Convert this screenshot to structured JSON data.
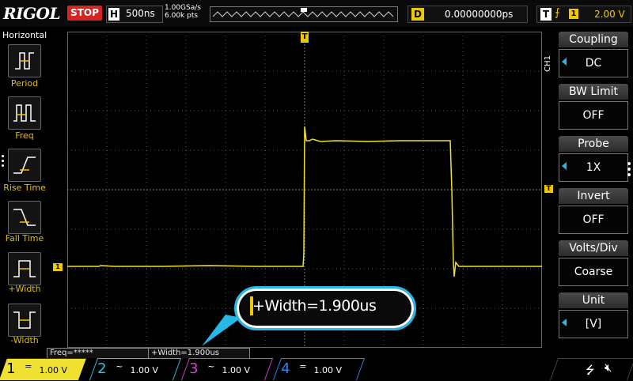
{
  "topbar": {
    "brand": "RIGOL",
    "run_state": "STOP",
    "horizontal_badge": "H",
    "timebase": "500ns",
    "sample_rate": "1.00GSa/s",
    "memory_depth": "6.00k pts",
    "delay_badge": "D",
    "delay_value": "0.00000000ps",
    "trigger_badge": "T",
    "trigger_source": "1",
    "trigger_level": "2.00 V"
  },
  "left_menu": {
    "title": "Horizontal",
    "items": [
      {
        "label": "Period",
        "icon": "period-icon"
      },
      {
        "label": "Freq",
        "icon": "frequency-icon"
      },
      {
        "label": "Rise Time",
        "icon": "rise-time-icon"
      },
      {
        "label": "Fall Time",
        "icon": "fall-time-icon"
      },
      {
        "label": "+Width",
        "icon": "positive-width-icon"
      },
      {
        "label": "-Width",
        "icon": "negative-width-icon"
      }
    ]
  },
  "waveform": {
    "trigger_marker": "T",
    "channel_marker": "1",
    "trace_color": "#f0e030"
  },
  "bubble": {
    "text": "+Width=1.900us"
  },
  "measurements": {
    "freq": "Freq=*****",
    "width": "+Width=1.900us"
  },
  "right_menu": {
    "channel_label": "CH1",
    "items": [
      {
        "label": "Coupling",
        "value": "DC",
        "has_arrow": true
      },
      {
        "label": "BW Limit",
        "value": "OFF",
        "has_arrow": false
      },
      {
        "label": "Probe",
        "value": "1X",
        "has_arrow": true
      },
      {
        "label": "Invert",
        "value": "OFF",
        "has_arrow": false
      },
      {
        "label": "Volts/Div",
        "value": "Coarse",
        "has_arrow": false
      },
      {
        "label": "Unit",
        "value": "[V]",
        "has_arrow": true
      }
    ]
  },
  "channels": [
    {
      "num": "1",
      "coupling": "=",
      "scale": "1.00 V",
      "color": "#f0e030",
      "active": true
    },
    {
      "num": "2",
      "coupling": "~",
      "scale": "1.00 V",
      "color": "#28c8d8",
      "active": false
    },
    {
      "num": "3",
      "coupling": "~",
      "scale": "1.00 V",
      "color": "#d040d0",
      "active": false
    },
    {
      "num": "4",
      "coupling": "=",
      "scale": "1.00 V",
      "color": "#3080f0",
      "active": false
    }
  ],
  "status_icons": [
    "usb-icon",
    "speaker-muted-icon"
  ]
}
